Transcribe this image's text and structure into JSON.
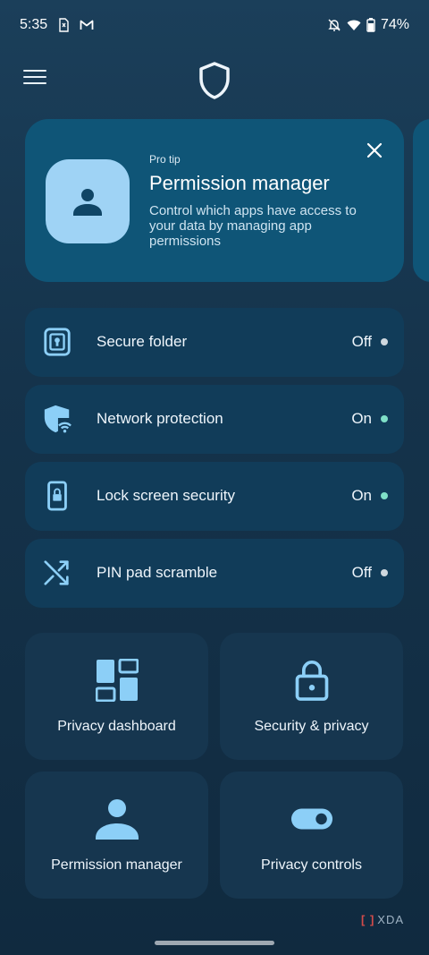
{
  "status_bar": {
    "time": "5:35",
    "left_icons": [
      "sim-alert-icon",
      "gmail-icon"
    ],
    "right_icons": [
      "bell-off-icon",
      "wifi-icon",
      "battery-icon"
    ],
    "battery": "74%"
  },
  "header": {
    "menu_icon": "hamburger-menu-icon",
    "logo_icon": "shield-icon"
  },
  "promo": {
    "eyebrow": "Pro tip",
    "title": "Permission manager",
    "description": "Control which apps have access to your data by managing app permissions",
    "icon": "person-icon",
    "close_icon": "close-icon"
  },
  "settings": [
    {
      "label": "Secure folder",
      "status": "Off",
      "icon": "secure-folder-icon",
      "dot_color": "#cfd8df"
    },
    {
      "label": "Network protection",
      "status": "On",
      "icon": "network-shield-icon",
      "dot_color": "#7fe0c8"
    },
    {
      "label": "Lock screen security",
      "status": "On",
      "icon": "phone-lock-icon",
      "dot_color": "#7fe0c8"
    },
    {
      "label": "PIN pad scramble",
      "status": "Off",
      "icon": "shuffle-icon",
      "dot_color": "#cfd8df"
    }
  ],
  "tiles": [
    {
      "label": "Privacy dashboard",
      "icon": "dashboard-icon"
    },
    {
      "label": "Security & privacy",
      "icon": "lock-icon"
    },
    {
      "label": "Permission manager",
      "icon": "person-icon"
    },
    {
      "label": "Privacy controls",
      "icon": "toggle-icon"
    }
  ],
  "colors": {
    "accent": "#8ccff7",
    "card": "#0f5577",
    "row": "#113c59",
    "tile": "#16364f",
    "on_dot": "#7fe0c8",
    "off_dot": "#cfd8df"
  },
  "watermark": "XDA"
}
